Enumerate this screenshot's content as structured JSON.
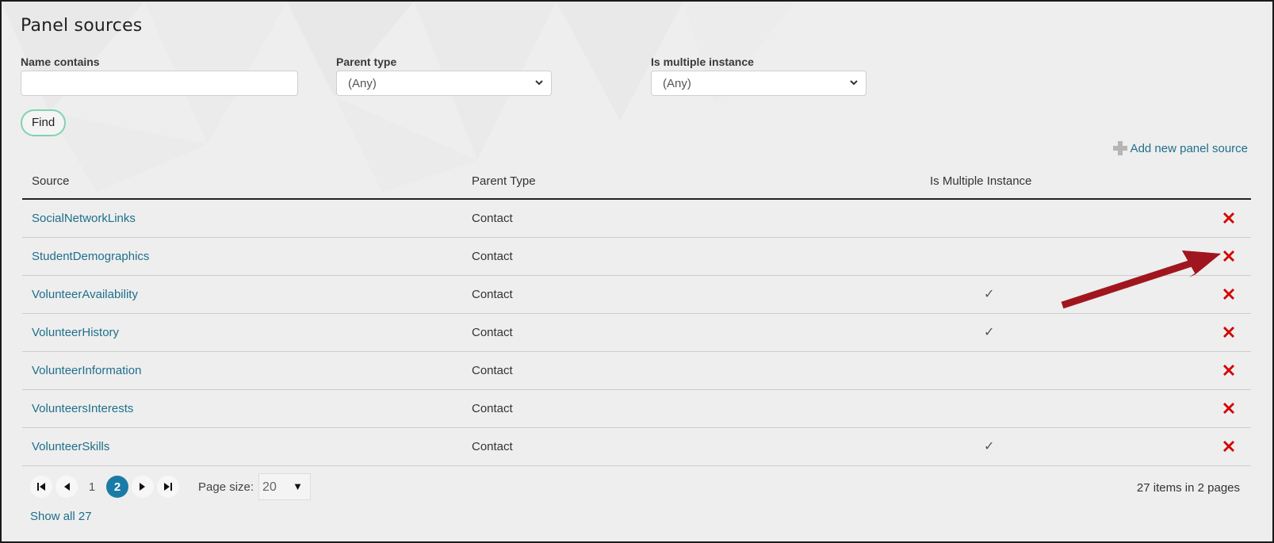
{
  "page": {
    "title": "Panel sources"
  },
  "filters": {
    "name_contains": {
      "label": "Name contains",
      "value": "",
      "placeholder": ""
    },
    "parent_type": {
      "label": "Parent type",
      "selected": "(Any)"
    },
    "is_multiple_instance": {
      "label": "Is multiple instance",
      "selected": "(Any)"
    },
    "find_label": "Find"
  },
  "actions": {
    "add_new_label": "Add new panel source"
  },
  "table": {
    "columns": [
      "Source",
      "Parent Type",
      "Is Multiple Instance",
      ""
    ],
    "rows": [
      {
        "source": "SocialNetworkLinks",
        "parent_type": "Contact",
        "multiple": ""
      },
      {
        "source": "StudentDemographics",
        "parent_type": "Contact",
        "multiple": ""
      },
      {
        "source": "VolunteerAvailability",
        "parent_type": "Contact",
        "multiple": "✓"
      },
      {
        "source": "VolunteerHistory",
        "parent_type": "Contact",
        "multiple": "✓"
      },
      {
        "source": "VolunteerInformation",
        "parent_type": "Contact",
        "multiple": ""
      },
      {
        "source": "VolunteersInterests",
        "parent_type": "Contact",
        "multiple": ""
      },
      {
        "source": "VolunteerSkills",
        "parent_type": "Contact",
        "multiple": "✓"
      }
    ],
    "delete_icon": "red-x-delete-icon"
  },
  "pager": {
    "pages": [
      "1",
      "2"
    ],
    "current_page": "2",
    "page_size_label": "Page size:",
    "page_size": "20",
    "summary": "27 items in 2 pages",
    "show_all_label": "Show all 27"
  },
  "annotation": {
    "type": "arrow",
    "points_to": "delete-button row StudentDemographics",
    "color": "#a0161f"
  },
  "colors": {
    "link": "#1f6f8b",
    "active_page": "#1a7ca6",
    "delete": "#d40000",
    "find_border": "#7fd3ae"
  }
}
